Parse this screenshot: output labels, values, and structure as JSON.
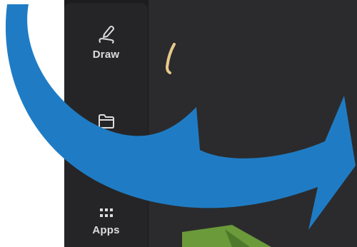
{
  "sidebar": {
    "items": [
      {
        "label": "Draw",
        "icon": "draw-icon"
      },
      {
        "label": "Projects",
        "icon": "folder-icon"
      },
      {
        "label": "Apps",
        "icon": "apps-icon"
      }
    ]
  },
  "colors": {
    "sidebar_bg": "#252527",
    "app_bg": "#1c1c1e",
    "canvas_bg": "#2b2b2d",
    "arrow": "#1f7cc4",
    "scribble": "#e8c98a",
    "green_shape": "#6a9a3a"
  }
}
